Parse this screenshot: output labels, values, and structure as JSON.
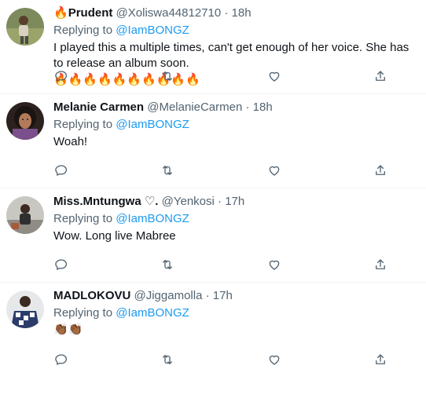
{
  "tweets": [
    {
      "prefix_emoji": "🔥",
      "name": "Prudent",
      "handle": "@Xoliswa44812710",
      "separator": "·",
      "time": "18h",
      "reply_prefix": "Replying to",
      "reply_to": "@IamBONGZ",
      "text": "I played this a multiple times, can't get enough of her voice. She has to release an album soon.",
      "emojis": "🔥🔥🔥🔥🔥🔥🔥🔥🔥🔥"
    },
    {
      "prefix_emoji": "",
      "name": "Melanie Carmen",
      "handle": "@MelanieCarmen",
      "separator": "·",
      "time": "18h",
      "reply_prefix": "Replying to",
      "reply_to": "@IamBONGZ",
      "text": "Woah!",
      "emojis": ""
    },
    {
      "prefix_emoji": "",
      "name": "Miss.Mntungwa ♡.",
      "handle": "@Yenkosi",
      "separator": "·",
      "time": "17h",
      "reply_prefix": "Replying to",
      "reply_to": "@IamBONGZ",
      "text": "Wow. Long live Mabree",
      "emojis": ""
    },
    {
      "prefix_emoji": "",
      "name": "MADLOKOVU",
      "handle": "@Jiggamolla",
      "separator": "·",
      "time": "17h",
      "reply_prefix": "Replying to",
      "reply_to": "@IamBONGZ",
      "text": "",
      "emojis": "👏🏾👏🏾"
    }
  ],
  "icons": {
    "reply": "reply-icon",
    "retweet": "retweet-icon",
    "like": "like-icon",
    "share": "share-icon"
  },
  "colors": {
    "text": "#0f1419",
    "secondary": "#536471",
    "mention": "#1d9bf0",
    "divider": "#eff3f4"
  }
}
